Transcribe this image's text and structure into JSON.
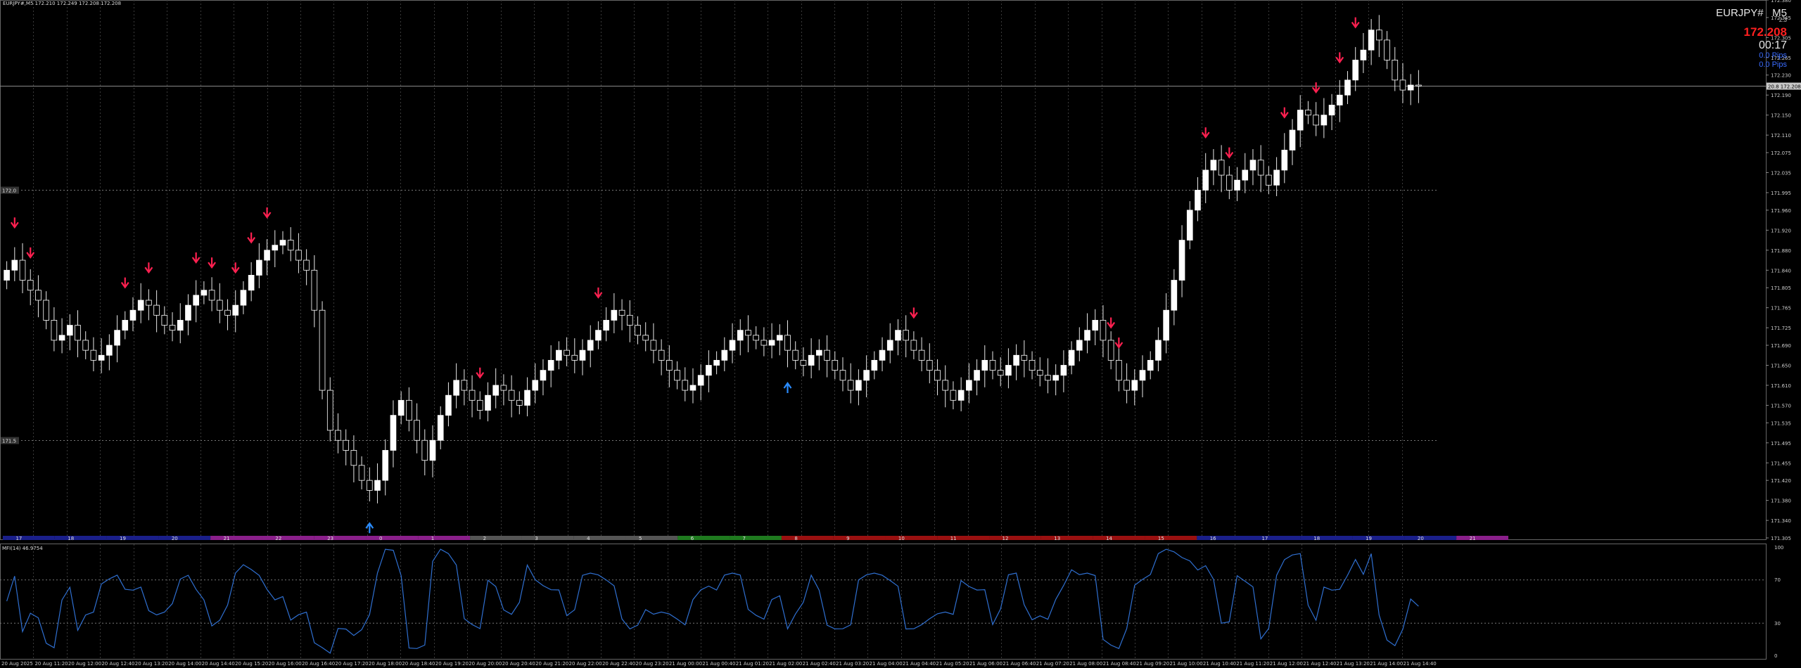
{
  "window": {
    "title": "EURJPY#,M5  172.210 172.249 172.208 172.208"
  },
  "info_panel": {
    "symbol": "EURJPY#",
    "timeframe": "M5",
    "spread": "2.3",
    "price": "172.208",
    "timer": "00:17",
    "pips_line1": "0.0 Pips",
    "pips_line2": "0.0 Pips"
  },
  "indicator": {
    "label": "MFI(14) 46.9754",
    "levels_text": [
      "100",
      "70",
      "30",
      "0"
    ]
  },
  "colors": {
    "background": "#000000",
    "bull_candle": "#ffffff",
    "bear_candle": "#ffffff",
    "sell_arrow": "#ff2050",
    "buy_arrow": "#2a8cff",
    "grid": "#3a3a3a",
    "mfi_line": "#2f6fd0",
    "price_line": "#888888"
  },
  "chart_data": {
    "type": "candlestick",
    "symbol": "EURJPY#",
    "timeframe": "M5",
    "price_axis_labels": [
      "172.380",
      "172.345",
      "172.305",
      "172.265",
      "172.230",
      "172.190",
      "172.150",
      "172.110",
      "172.075",
      "172.035",
      "171.995",
      "171.960",
      "171.920",
      "171.880",
      "171.840",
      "171.805",
      "171.765",
      "171.725",
      "171.690",
      "171.650",
      "171.610",
      "171.570",
      "171.535",
      "171.495",
      "171.455",
      "171.420",
      "171.380",
      "171.340",
      "171.305"
    ],
    "ylim": [
      171.305,
      172.38
    ],
    "current_price": 172.208,
    "current_price_label": "172.208",
    "current_price_tag": "20.8",
    "level_labels": [
      "172.0",
      "171.5"
    ],
    "levels": [
      172.0,
      171.5
    ],
    "time_labels": [
      "20 Aug 2025",
      "20 Aug 11:20",
      "20 Aug 12:00",
      "20 Aug 12:40",
      "20 Aug 13:20",
      "20 Aug 14:00",
      "20 Aug 14:40",
      "20 Aug 15:20",
      "20 Aug 16:00",
      "20 Aug 16:40",
      "20 Aug 17:20",
      "20 Aug 18:00",
      "20 Aug 18:40",
      "20 Aug 19:20",
      "20 Aug 20:00",
      "20 Aug 20:40",
      "20 Aug 21:20",
      "20 Aug 22:00",
      "20 Aug 22:40",
      "20 Aug 23:20",
      "21 Aug 00:00",
      "21 Aug 00:40",
      "21 Aug 01:20",
      "21 Aug 02:00",
      "21 Aug 02:40",
      "21 Aug 03:20",
      "21 Aug 04:00",
      "21 Aug 04:40",
      "21 Aug 05:20",
      "21 Aug 06:00",
      "21 Aug 06:40",
      "21 Aug 07:20",
      "21 Aug 08:00",
      "21 Aug 08:40",
      "21 Aug 09:20",
      "21 Aug 10:00",
      "21 Aug 10:40",
      "21 Aug 11:20",
      "21 Aug 12:00",
      "21 Aug 12:40",
      "21 Aug 13:20",
      "21 Aug 14:00",
      "21 Aug 14:40"
    ],
    "session_hours": [
      "17",
      "18",
      "19",
      "20",
      "21",
      "22",
      "23",
      "0",
      "1",
      "2",
      "3",
      "4",
      "5",
      "6",
      "7",
      "8",
      "9",
      "10",
      "11",
      "12",
      "13",
      "14",
      "15",
      "16",
      "17",
      "18",
      "19",
      "20",
      "21"
    ],
    "session_colors": [
      "#1a1f8a",
      "#1a1f8a",
      "#1a1f8a",
      "#1a1f8a",
      "#8a1f8a",
      "#8a1f8a",
      "#8a1f8a",
      "#8a1f8a",
      "#8a1f8a",
      "#555555",
      "#555555",
      "#555555",
      "#555555",
      "#1f7a1f",
      "#1f7a1f",
      "#9a1010",
      "#9a1010",
      "#9a1010",
      "#9a1010",
      "#9a1010",
      "#9a1010",
      "#9a1010",
      "#9a1010",
      "#1a1f8a",
      "#1a1f8a",
      "#1a1f8a",
      "#1a1f8a",
      "#1a1f8a",
      "#8a1f8a"
    ],
    "closes": [
      171.84,
      171.86,
      171.82,
      171.8,
      171.78,
      171.74,
      171.7,
      171.71,
      171.73,
      171.7,
      171.68,
      171.66,
      171.67,
      171.69,
      171.72,
      171.74,
      171.76,
      171.78,
      171.77,
      171.75,
      171.73,
      171.72,
      171.74,
      171.77,
      171.79,
      171.8,
      171.78,
      171.76,
      171.75,
      171.77,
      171.8,
      171.83,
      171.86,
      171.88,
      171.89,
      171.9,
      171.88,
      171.86,
      171.84,
      171.76,
      171.6,
      171.52,
      171.5,
      171.48,
      171.45,
      171.42,
      171.4,
      171.42,
      171.48,
      171.55,
      171.58,
      171.54,
      171.5,
      171.46,
      171.5,
      171.55,
      171.59,
      171.62,
      171.6,
      171.58,
      171.56,
      171.59,
      171.61,
      171.6,
      171.58,
      171.57,
      171.6,
      171.62,
      171.64,
      171.66,
      171.68,
      171.67,
      171.66,
      171.68,
      171.7,
      171.72,
      171.74,
      171.76,
      171.75,
      171.73,
      171.71,
      171.7,
      171.68,
      171.66,
      171.64,
      171.62,
      171.6,
      171.61,
      171.63,
      171.65,
      171.66,
      171.68,
      171.7,
      171.72,
      171.71,
      171.7,
      171.69,
      171.7,
      171.71,
      171.68,
      171.66,
      171.65,
      171.67,
      171.68,
      171.66,
      171.64,
      171.62,
      171.6,
      171.62,
      171.64,
      171.66,
      171.68,
      171.7,
      171.72,
      171.7,
      171.68,
      171.66,
      171.64,
      171.62,
      171.6,
      171.58,
      171.6,
      171.62,
      171.64,
      171.66,
      171.64,
      171.63,
      171.65,
      171.67,
      171.66,
      171.64,
      171.63,
      171.62,
      171.63,
      171.65,
      171.68,
      171.7,
      171.72,
      171.74,
      171.7,
      171.66,
      171.62,
      171.6,
      171.62,
      171.64,
      171.66,
      171.7,
      171.76,
      171.82,
      171.9,
      171.96,
      172.0,
      172.04,
      172.06,
      172.03,
      172.0,
      172.02,
      172.04,
      172.06,
      172.03,
      172.01,
      172.04,
      172.08,
      172.12,
      172.16,
      172.15,
      172.13,
      172.15,
      172.17,
      172.19,
      172.22,
      172.26,
      172.28,
      172.32,
      172.3,
      172.26,
      172.22,
      172.2,
      172.21,
      172.208
    ]
  }
}
